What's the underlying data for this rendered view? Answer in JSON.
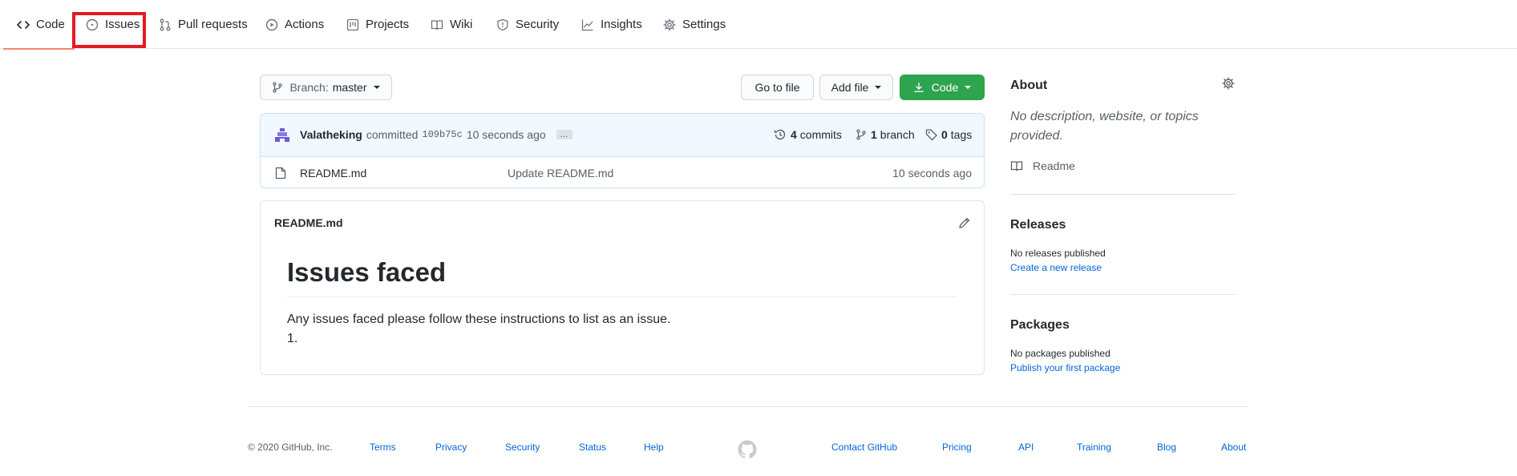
{
  "nav": {
    "tabs": [
      {
        "label": "Code",
        "icon": "code-icon"
      },
      {
        "label": "Issues",
        "icon": "issue-opened-icon"
      },
      {
        "label": "Pull requests",
        "icon": "git-pull-request-icon"
      },
      {
        "label": "Actions",
        "icon": "play-icon"
      },
      {
        "label": "Projects",
        "icon": "project-icon"
      },
      {
        "label": "Wiki",
        "icon": "book-icon"
      },
      {
        "label": "Security",
        "icon": "shield-icon"
      },
      {
        "label": "Insights",
        "icon": "graph-icon"
      },
      {
        "label": "Settings",
        "icon": "gear-icon"
      }
    ],
    "selected": "Code",
    "highlighted": "Issues",
    "highlight_color": "#e31b23",
    "selected_underline_color": "#f9826c"
  },
  "toolbar": {
    "branch_prefix": "Branch:",
    "branch_name": "master",
    "go_to_file": "Go to file",
    "add_file": "Add file",
    "code": "Code",
    "green": "#2ea44f"
  },
  "commit": {
    "author": "Valatheking",
    "verb": "committed",
    "sha": "109b75c",
    "time": "10 seconds ago",
    "ellipsis": "…",
    "commits_count": "4",
    "commits_label": "commits",
    "branches_count": "1",
    "branches_label": "branch",
    "tags_count": "0",
    "tags_label": "tags"
  },
  "files": [
    {
      "name": "README.md",
      "message": "Update README.md",
      "age": "10 seconds ago"
    }
  ],
  "readme": {
    "filename": "README.md",
    "heading": "Issues faced",
    "paragraph": "Any issues faced please follow these instructions to list as an issue.",
    "list_item": "1."
  },
  "sidebar": {
    "about_title": "About",
    "about_desc": "No description, website, or topics provided.",
    "readme_link": "Readme",
    "releases_title": "Releases",
    "releases_none": "No releases published",
    "releases_create": "Create a new release",
    "packages_title": "Packages",
    "packages_none": "No packages published",
    "packages_publish": "Publish your first package"
  },
  "footer": {
    "copyright": "© 2020 GitHub, Inc.",
    "left_links": [
      "Terms",
      "Privacy",
      "Security",
      "Status",
      "Help"
    ],
    "right_links": [
      "Contact GitHub",
      "Pricing",
      "API",
      "Training",
      "Blog",
      "About"
    ]
  }
}
